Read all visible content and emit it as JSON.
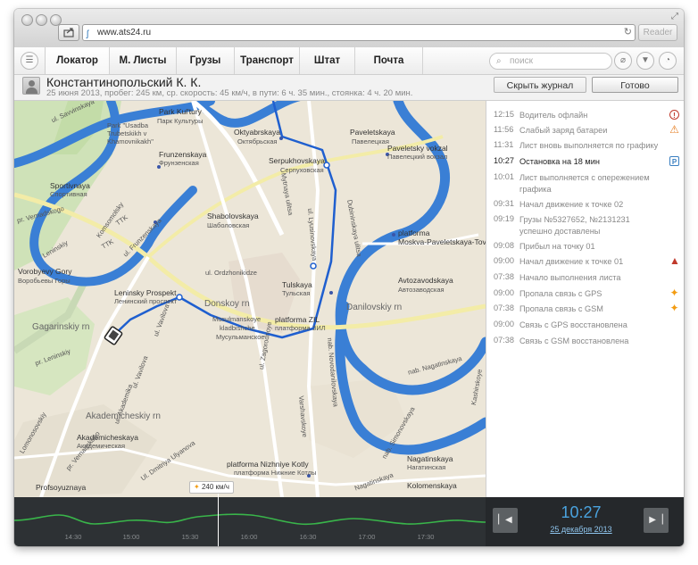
{
  "browser": {
    "url": "www.ats24.ru",
    "reader_label": "Reader"
  },
  "nav": {
    "tabs": [
      {
        "label": "Локатор"
      },
      {
        "label": "М. Листы"
      },
      {
        "label": "Грузы"
      },
      {
        "label": "Транспорт"
      },
      {
        "label": "Штат"
      },
      {
        "label": "Почта"
      }
    ],
    "search_placeholder": "поиск"
  },
  "driver": {
    "name": "Константинопольский К. К.",
    "info": "25 июня 2013, пробег: 245 км, ср. скорость: 45 км/ч, в пути: 6 ч. 35 мин., стоянка: 4 ч. 20 мин.",
    "hide_log_label": "Скрыть журнал",
    "done_label": "Готово"
  },
  "map": {
    "labels": [
      {
        "text": "Park Kul'tury",
        "kind": "name"
      },
      {
        "text": "Парк Культуры",
        "kind": "rus"
      },
      {
        "text": "Oktyabrskaya",
        "kind": "name"
      },
      {
        "text": "Октябрьская",
        "kind": "rus"
      },
      {
        "text": "Paveletskaya",
        "kind": "name"
      },
      {
        "text": "Павелецкая",
        "kind": "rus"
      },
      {
        "text": "Paveletsky vokzal",
        "kind": "name"
      },
      {
        "text": "Павелецкий вокзал",
        "kind": "rus"
      },
      {
        "text": "Park \"Usadba",
        "kind": "sub"
      },
      {
        "text": "Trubetskikh v",
        "kind": "sub"
      },
      {
        "text": "Khamovnikakh\"",
        "kind": "sub"
      },
      {
        "text": "Frunzenskaya",
        "kind": "name"
      },
      {
        "text": "Фрунзенская",
        "kind": "rus"
      },
      {
        "text": "Serpukhovskaya",
        "kind": "name"
      },
      {
        "text": "Серпуховская",
        "kind": "rus"
      },
      {
        "text": "Sportivnaya",
        "kind": "name"
      },
      {
        "text": "Спортивная",
        "kind": "rus"
      },
      {
        "text": "Shabolovskaya",
        "kind": "name"
      },
      {
        "text": "Шаболовская",
        "kind": "rus"
      },
      {
        "text": "platforma",
        "kind": "name"
      },
      {
        "text": "Moskva-Paveletskaya-Tovarnaya",
        "kind": "name"
      },
      {
        "text": "Vorobyevy Gory",
        "kind": "name"
      },
      {
        "text": "Воробьевы Горы",
        "kind": "rus"
      },
      {
        "text": "ul. Ordzhonikidze",
        "kind": "sub"
      },
      {
        "text": "Tulskaya",
        "kind": "name"
      },
      {
        "text": "Тульская",
        "kind": "rus"
      },
      {
        "text": "Avtozavodskaya",
        "kind": "name"
      },
      {
        "text": "Автозаводская",
        "kind": "rus"
      },
      {
        "text": "Leninsky Prospekt",
        "kind": "name"
      },
      {
        "text": "Ленинский проспект",
        "kind": "rus"
      },
      {
        "text": "Donskoy rn",
        "kind": "area"
      },
      {
        "text": "Danilovskiy rn",
        "kind": "area"
      },
      {
        "text": "Gagarinskiy rn",
        "kind": "area"
      },
      {
        "text": "Musulmanskoye",
        "kind": "sub"
      },
      {
        "text": "kladbishche",
        "kind": "sub"
      },
      {
        "text": "Мусульманское",
        "kind": "rus"
      },
      {
        "text": "platforma ZIL",
        "kind": "name"
      },
      {
        "text": "платформа ЗИЛ",
        "kind": "rus"
      },
      {
        "text": "Akademicheskiy rn",
        "kind": "area"
      },
      {
        "text": "Akademicheskaya",
        "kind": "name"
      },
      {
        "text": "Академическая",
        "kind": "rus"
      },
      {
        "text": "platforma Nizhniye Kotly",
        "kind": "name"
      },
      {
        "text": "платформа Нижние Котлы",
        "kind": "rus"
      },
      {
        "text": "Nagatinskaya",
        "kind": "name"
      },
      {
        "text": "Нагатинская",
        "kind": "rus"
      },
      {
        "text": "Profsoyuznaya",
        "kind": "name"
      },
      {
        "text": "Kolomenskaya",
        "kind": "name"
      },
      {
        "text": "ul. Vavilova",
        "kind": "sub"
      },
      {
        "text": "Mytnaya ulitsa",
        "kind": "sub"
      },
      {
        "text": "ul. Lyusinovskaya",
        "kind": "sub"
      },
      {
        "text": "Dubininskaya ulitsa",
        "kind": "sub"
      },
      {
        "text": "nab. Novodanilovskaya",
        "kind": "sub"
      },
      {
        "text": "Varshavskoye",
        "kind": "sub"
      },
      {
        "text": "Leninskiy",
        "kind": "sub"
      },
      {
        "text": "pr. Vernadskogo",
        "kind": "sub"
      },
      {
        "text": "ul. Zagorodnoye",
        "kind": "sub"
      },
      {
        "text": "nab. Simonovskaya",
        "kind": "sub"
      },
      {
        "text": "ul. Savvinskaya",
        "kind": "sub"
      },
      {
        "text": "ul. Frunzenskaya",
        "kind": "sub"
      },
      {
        "text": "Komsomolsky",
        "kind": "sub"
      },
      {
        "text": "TTK",
        "kind": "sub"
      },
      {
        "text": "TTK",
        "kind": "sub"
      },
      {
        "text": "Lomonosovskiy",
        "kind": "sub"
      },
      {
        "text": "pr. Leninskiy",
        "kind": "sub"
      },
      {
        "text": "Nagatinskaya",
        "kind": "sub"
      },
      {
        "text": "nab. Nagatinskaya",
        "kind": "sub"
      },
      {
        "text": "Kashirskoye",
        "kind": "sub"
      },
      {
        "text": "ul. Akademika",
        "kind": "sub"
      },
      {
        "text": "Ul. Dmitriya Ulyanova",
        "kind": "sub"
      },
      {
        "text": "pr. Vernadskogo",
        "kind": "sub"
      },
      {
        "text": "ul. Vavilova",
        "kind": "sub"
      }
    ],
    "route_color": "#1f5fcf",
    "river_color": "#3a7fd5"
  },
  "events": [
    {
      "time": "12:15",
      "text": "Водитель офлайн",
      "icon": "alert-icon",
      "current": false
    },
    {
      "time": "11:56",
      "text": "Слабый заряд батареи",
      "icon": "warning-icon",
      "current": false
    },
    {
      "time": "11:31",
      "text": "Лист вновь выполняется по графику",
      "icon": "",
      "current": false
    },
    {
      "time": "10:27",
      "text": "Остановка на 18 мин",
      "icon": "parking-icon",
      "current": true
    },
    {
      "time": "10:01",
      "text": "Лист выполняется с опережением графика",
      "icon": "",
      "current": false
    },
    {
      "time": "09:31",
      "text": "Начал движение к точке 02",
      "icon": "",
      "current": false
    },
    {
      "time": "09:19",
      "text": "Грузы №5327652, №2131231 успешно доставлены",
      "icon": "",
      "current": false
    },
    {
      "time": "09:08",
      "text": "Прибыл на точку 01",
      "icon": "",
      "current": false
    },
    {
      "time": "09:00",
      "text": "Начал движение к точке 01",
      "icon": "triangle-alert-icon",
      "current": false
    },
    {
      "time": "07:38",
      "text": "Начало выполнения листа",
      "icon": "",
      "current": false
    },
    {
      "time": "09:00",
      "text": "Пропала связь с GPS",
      "icon": "signal-lost-icon",
      "current": false
    },
    {
      "time": "07:38",
      "text": "Пропала связь с GSM",
      "icon": "signal-lost-icon",
      "current": false
    },
    {
      "time": "09:00",
      "text": "Связь с GPS восстановлена",
      "icon": "",
      "current": false
    },
    {
      "time": "07:38",
      "text": "Связь с GSM восстановлена",
      "icon": "",
      "current": false
    }
  ],
  "timeline": {
    "ticks": [
      "14:30",
      "15:00",
      "15:30",
      "16:00",
      "16:30",
      "17:00",
      "17:30"
    ],
    "speed_badge": "240 км/ч",
    "current_time": "10:27",
    "current_date": "25 декабря 2013",
    "line_color": "#39b54a"
  }
}
